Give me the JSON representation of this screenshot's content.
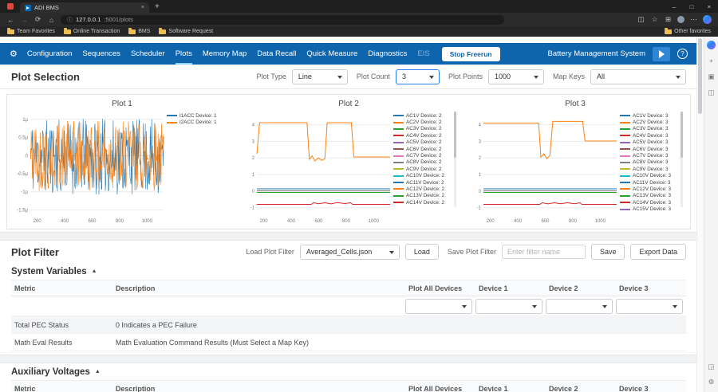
{
  "browser": {
    "tab_title": "ADI BMS",
    "url_host": "127.0.0.1",
    "url_path": ":5001/plots",
    "favorites": [
      "Team Favorites",
      "Online Transaction",
      "BMS",
      "Software Request"
    ],
    "other_favorites": "Other favorites"
  },
  "icons": {
    "back": "←",
    "forward": "→",
    "refresh": "⟳",
    "home": "⌂",
    "info": "ⓘ",
    "star": "☆",
    "collections": "⊞",
    "menu": "⋯",
    "gear": "⚙",
    "help": "?",
    "minimize": "–",
    "maximize": "□",
    "close": "×",
    "new_tab": "+",
    "collapse": "▲",
    "plus": "+",
    "apps": "▣",
    "split": "◫",
    "screenshot": "◲"
  },
  "nav": {
    "items": [
      "Configuration",
      "Sequences",
      "Scheduler",
      "Plots",
      "Memory Map",
      "Data Recall",
      "Quick Measure",
      "Diagnostics",
      "EIS"
    ],
    "active": "Plots",
    "stop_button": "Stop Freerun",
    "app_title": "Battery Management System"
  },
  "plot_selection": {
    "title": "Plot Selection",
    "plot_type_label": "Plot Type",
    "plot_type_value": "Line",
    "plot_count_label": "Plot Count",
    "plot_count_value": "3",
    "plot_points_label": "Plot Points",
    "plot_points_value": "1000",
    "map_keys_label": "Map Keys",
    "map_keys_value": "All"
  },
  "chart_data": [
    {
      "type": "line",
      "title": "Plot 1",
      "xlim": [
        150,
        1120
      ],
      "ylim": [
        -1.6,
        1.15
      ],
      "x_ticks": [
        200,
        400,
        600,
        800,
        1000
      ],
      "y_ticks": [
        {
          "v": 1,
          "label": "1μ"
        },
        {
          "v": 0.5,
          "label": "0.5μ"
        },
        {
          "v": 0,
          "label": "0"
        },
        {
          "v": -0.5,
          "label": "-0.5μ"
        },
        {
          "v": -1,
          "label": "-1μ"
        },
        {
          "v": -1.5,
          "label": "-1.5μ"
        }
      ],
      "legend": [
        {
          "name": "I1ACC Device: 1",
          "color": "#1f77b4"
        },
        {
          "name": "I2ACC Device: 1",
          "color": "#ff7f0e"
        }
      ],
      "legend_scroll": false,
      "series": [
        {
          "name": "I1ACC Device: 1",
          "color": "#1f77b4",
          "kind": "noise",
          "range": [
            -1.08,
            1.02
          ],
          "seed": 11
        },
        {
          "name": "I2ACC Device: 1",
          "color": "#ff7f0e",
          "kind": "noise",
          "range": [
            -0.98,
            0.96
          ],
          "seed": 42
        }
      ]
    },
    {
      "type": "line",
      "title": "Plot 2",
      "xlim": [
        150,
        1120
      ],
      "ylim": [
        -1.35,
        4.65
      ],
      "x_ticks": [
        200,
        400,
        600,
        800,
        1000
      ],
      "y_ticks": [
        {
          "v": 4,
          "label": "4"
        },
        {
          "v": 3,
          "label": "3"
        },
        {
          "v": 2,
          "label": "2"
        },
        {
          "v": 1,
          "label": "1"
        },
        {
          "v": 0,
          "label": "0"
        },
        {
          "v": -1,
          "label": "-1"
        }
      ],
      "legend": [
        {
          "name": "AC1V Device: 2",
          "color": "#1f77b4"
        },
        {
          "name": "AC2V Device: 2",
          "color": "#ff7f0e"
        },
        {
          "name": "AC3V Device: 2",
          "color": "#2ca02c"
        },
        {
          "name": "AC4V Device: 2",
          "color": "#d62728"
        },
        {
          "name": "AC5V Device: 2",
          "color": "#9467bd"
        },
        {
          "name": "AC6V Device: 2",
          "color": "#8c564b"
        },
        {
          "name": "AC7V Device: 2",
          "color": "#e377c2"
        },
        {
          "name": "AC8V Device: 2",
          "color": "#7f7f7f"
        },
        {
          "name": "AC9V Device: 2",
          "color": "#bcbd22"
        },
        {
          "name": "AC10V Device: 2",
          "color": "#17becf"
        },
        {
          "name": "AC11V Device: 2",
          "color": "#1f77b4"
        },
        {
          "name": "AC12V Device: 2",
          "color": "#ff7f0e"
        },
        {
          "name": "AC13V Device: 2",
          "color": "#2ca02c"
        },
        {
          "name": "AC14V Device: 2",
          "color": "#d62728"
        }
      ],
      "legend_scroll": true,
      "series": [
        {
          "name": "AC2V Device: 2",
          "color": "#ff7f0e",
          "kind": "points",
          "points": [
            [
              150,
              2.25
            ],
            [
              170,
              4.12
            ],
            [
              515,
              4.12
            ],
            [
              532,
              1.92
            ],
            [
              552,
              2.12
            ],
            [
              572,
              1.82
            ],
            [
              598,
              2.0
            ],
            [
              622,
              1.85
            ],
            [
              645,
              1.95
            ],
            [
              662,
              4.12
            ],
            [
              838,
              4.12
            ],
            [
              856,
              2.06
            ],
            [
              1120,
              2.06
            ]
          ]
        },
        {
          "name": "AC1V Device: 2",
          "color": "#1f77b4",
          "kind": "points",
          "points": [
            [
              150,
              0.14
            ],
            [
              1120,
              0.14
            ]
          ]
        },
        {
          "name": "AC8V Device: 2",
          "color": "#7f7f7f",
          "kind": "points",
          "points": [
            [
              150,
              0.02
            ],
            [
              1120,
              0.02
            ]
          ]
        },
        {
          "name": "AC3V Device: 2",
          "color": "#2ca02c",
          "kind": "points",
          "points": [
            [
              150,
              -0.08
            ],
            [
              1120,
              -0.08
            ]
          ]
        },
        {
          "name": "AC14V Device: 2",
          "color": "#d62728",
          "kind": "points",
          "points": [
            [
              150,
              -0.8
            ],
            [
              545,
              -0.8
            ],
            [
              565,
              -0.7
            ],
            [
              600,
              -0.76
            ],
            [
              645,
              -0.7
            ],
            [
              690,
              -0.77
            ],
            [
              735,
              -0.69
            ],
            [
              790,
              -0.75
            ],
            [
              830,
              -0.7
            ],
            [
              848,
              -0.8
            ],
            [
              1120,
              -0.8
            ]
          ]
        }
      ]
    },
    {
      "type": "line",
      "title": "Plot 3",
      "xlim": [
        150,
        1120
      ],
      "ylim": [
        -1.35,
        4.65
      ],
      "x_ticks": [
        200,
        400,
        600,
        800,
        1000
      ],
      "y_ticks": [
        {
          "v": 4,
          "label": "4"
        },
        {
          "v": 3,
          "label": "3"
        },
        {
          "v": 2,
          "label": "2"
        },
        {
          "v": 1,
          "label": "1"
        },
        {
          "v": 0,
          "label": "0"
        },
        {
          "v": -1,
          "label": "-1"
        }
      ],
      "legend": [
        {
          "name": "AC1V Device: 3",
          "color": "#1f77b4"
        },
        {
          "name": "AC2V Device: 3",
          "color": "#ff7f0e"
        },
        {
          "name": "AC3V Device: 3",
          "color": "#2ca02c"
        },
        {
          "name": "AC4V Device: 3",
          "color": "#d62728"
        },
        {
          "name": "AC5V Device: 3",
          "color": "#9467bd"
        },
        {
          "name": "AC6V Device: 3",
          "color": "#8c564b"
        },
        {
          "name": "AC7V Device: 3",
          "color": "#e377c2"
        },
        {
          "name": "AC8V Device: 3",
          "color": "#7f7f7f"
        },
        {
          "name": "AC9V Device: 3",
          "color": "#bcbd22"
        },
        {
          "name": "AC10V Device: 3",
          "color": "#17becf"
        },
        {
          "name": "AC11V Device: 3",
          "color": "#1f77b4"
        },
        {
          "name": "AC12V Device: 3",
          "color": "#ff7f0e"
        },
        {
          "name": "AC13V Device: 3",
          "color": "#2ca02c"
        },
        {
          "name": "AC14V Device: 3",
          "color": "#d62728"
        },
        {
          "name": "AC15V Device: 3",
          "color": "#9467bd"
        }
      ],
      "legend_scroll": true,
      "series": [
        {
          "name": "AC2V Device: 3",
          "color": "#ff7f0e",
          "kind": "points",
          "points": [
            [
              150,
              4.1
            ],
            [
              552,
              4.1
            ],
            [
              568,
              2.05
            ],
            [
              590,
              2.25
            ],
            [
              612,
              1.95
            ],
            [
              634,
              2.15
            ],
            [
              655,
              4.2
            ],
            [
              872,
              4.2
            ],
            [
              890,
              3.02
            ],
            [
              1120,
              3.02
            ]
          ]
        },
        {
          "name": "AC1V Device: 3",
          "color": "#1f77b4",
          "kind": "points",
          "points": [
            [
              150,
              0.14
            ],
            [
              1120,
              0.14
            ]
          ]
        },
        {
          "name": "AC8V Device: 3",
          "color": "#7f7f7f",
          "kind": "points",
          "points": [
            [
              150,
              0.02
            ],
            [
              1120,
              0.02
            ]
          ]
        },
        {
          "name": "AC3V Device: 3",
          "color": "#2ca02c",
          "kind": "points",
          "points": [
            [
              150,
              -0.08
            ],
            [
              1120,
              -0.08
            ]
          ]
        },
        {
          "name": "AC14V Device: 3",
          "color": "#d62728",
          "kind": "points",
          "points": [
            [
              150,
              -0.8
            ],
            [
              560,
              -0.8
            ],
            [
              578,
              -0.7
            ],
            [
              620,
              -0.77
            ],
            [
              665,
              -0.7
            ],
            [
              710,
              -0.76
            ],
            [
              760,
              -0.7
            ],
            [
              815,
              -0.76
            ],
            [
              850,
              -0.7
            ],
            [
              868,
              -0.8
            ],
            [
              1120,
              -0.8
            ]
          ]
        }
      ]
    }
  ],
  "plot_filter": {
    "title": "Plot Filter",
    "load_label": "Load Plot Filter",
    "load_value": "Averaged_Cells.json",
    "load_button": "Load",
    "save_label": "Save Plot Filter",
    "save_placeholder": "Enter filter name",
    "save_button": "Save",
    "export_button": "Export Data"
  },
  "system_variables": {
    "title": "System Variables",
    "columns": [
      "Metric",
      "Description",
      "Plot All Devices",
      "Device 1",
      "Device 2",
      "Device 3"
    ],
    "rows": [
      {
        "metric": "",
        "description": ""
      },
      {
        "metric": "Total PEC Status",
        "description": "0 Indicates a PEC Failure"
      },
      {
        "metric": "Math Eval Results",
        "description": "Math Evaluation Command Results (Must Select a Map Key)"
      }
    ]
  },
  "auxiliary_voltages": {
    "title": "Auxiliary Voltages",
    "columns": [
      "Metric",
      "Description",
      "Plot All Devices",
      "Device 1",
      "Device 2",
      "Device 3"
    ]
  },
  "colors": {
    "accent": "#0e64ad",
    "nav_underline": "#8ed0ff",
    "adi_logo_blue": "#2f86d6"
  }
}
